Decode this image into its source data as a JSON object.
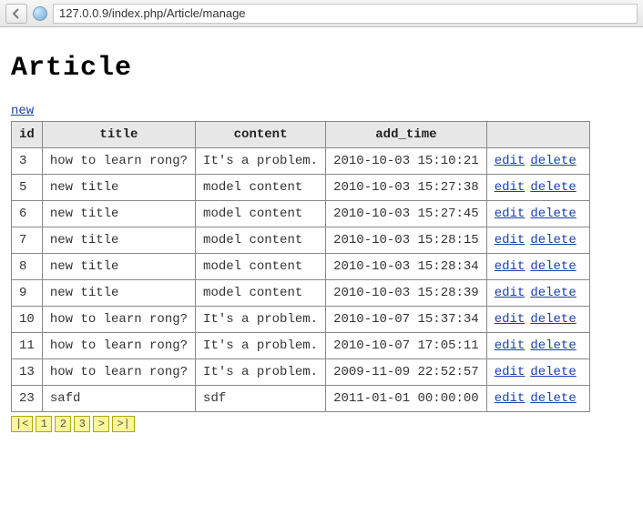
{
  "browser": {
    "url": "127.0.0.9/index.php/Article/manage"
  },
  "page": {
    "heading": "Article",
    "new_link": "new"
  },
  "table": {
    "headers": [
      "id",
      "title",
      "content",
      "add_time",
      ""
    ],
    "actions": {
      "edit": "edit",
      "delete": "delete"
    },
    "rows": [
      {
        "id": "3",
        "title": "how to learn rong?",
        "content": "It's a problem.",
        "add_time": "2010-10-03 15:10:21"
      },
      {
        "id": "5",
        "title": "new title",
        "content": "model content",
        "add_time": "2010-10-03 15:27:38"
      },
      {
        "id": "6",
        "title": "new title",
        "content": "model content",
        "add_time": "2010-10-03 15:27:45"
      },
      {
        "id": "7",
        "title": "new title",
        "content": "model content",
        "add_time": "2010-10-03 15:28:15"
      },
      {
        "id": "8",
        "title": "new title",
        "content": "model content",
        "add_time": "2010-10-03 15:28:34"
      },
      {
        "id": "9",
        "title": "new title",
        "content": "model content",
        "add_time": "2010-10-03 15:28:39"
      },
      {
        "id": "10",
        "title": "how to learn rong?",
        "content": "It's a problem.",
        "add_time": "2010-10-07 15:37:34"
      },
      {
        "id": "11",
        "title": "how to learn rong?",
        "content": "It's a problem.",
        "add_time": "2010-10-07 17:05:11"
      },
      {
        "id": "13",
        "title": "how to learn rong?",
        "content": "It's a problem.",
        "add_time": "2009-11-09 22:52:57"
      },
      {
        "id": "23",
        "title": "safd",
        "content": "sdf",
        "add_time": "2011-01-01 00:00:00"
      }
    ]
  },
  "pager": {
    "first": "|<",
    "pages": [
      "1",
      "2",
      "3"
    ],
    "next": ">",
    "last": ">|"
  }
}
